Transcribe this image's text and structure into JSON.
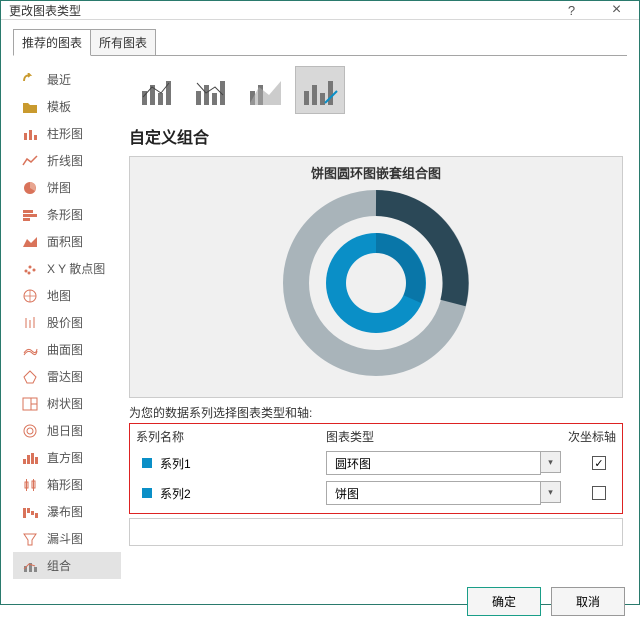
{
  "window": {
    "title": "更改图表类型"
  },
  "tabs": {
    "recommended": "推荐的图表",
    "all": "所有图表"
  },
  "sidebar": {
    "items": [
      {
        "label": "最近"
      },
      {
        "label": "模板"
      },
      {
        "label": "柱形图"
      },
      {
        "label": "折线图"
      },
      {
        "label": "饼图"
      },
      {
        "label": "条形图"
      },
      {
        "label": "面积图"
      },
      {
        "label": "X Y 散点图"
      },
      {
        "label": "地图"
      },
      {
        "label": "股价图"
      },
      {
        "label": "曲面图"
      },
      {
        "label": "雷达图"
      },
      {
        "label": "树状图"
      },
      {
        "label": "旭日图"
      },
      {
        "label": "直方图"
      },
      {
        "label": "箱形图"
      },
      {
        "label": "瀑布图"
      },
      {
        "label": "漏斗图"
      },
      {
        "label": "组合"
      }
    ]
  },
  "main": {
    "subtitle": "自定义组合",
    "preview_title": "饼图圆环图嵌套组合图",
    "table_label": "为您的数据系列选择图表类型和轴:",
    "headers": {
      "name": "系列名称",
      "type": "图表类型",
      "axis": "次坐标轴"
    },
    "series": [
      {
        "name": "系列1",
        "chart_type": "圆环图",
        "secondary_axis": true
      },
      {
        "name": "系列2",
        "chart_type": "饼图",
        "secondary_axis": false
      }
    ]
  },
  "footer": {
    "ok": "确定",
    "cancel": "取消"
  },
  "colors": {
    "accent": "#0a8fc7",
    "dark": "#2b4857",
    "grey": "#a9b4ba"
  }
}
